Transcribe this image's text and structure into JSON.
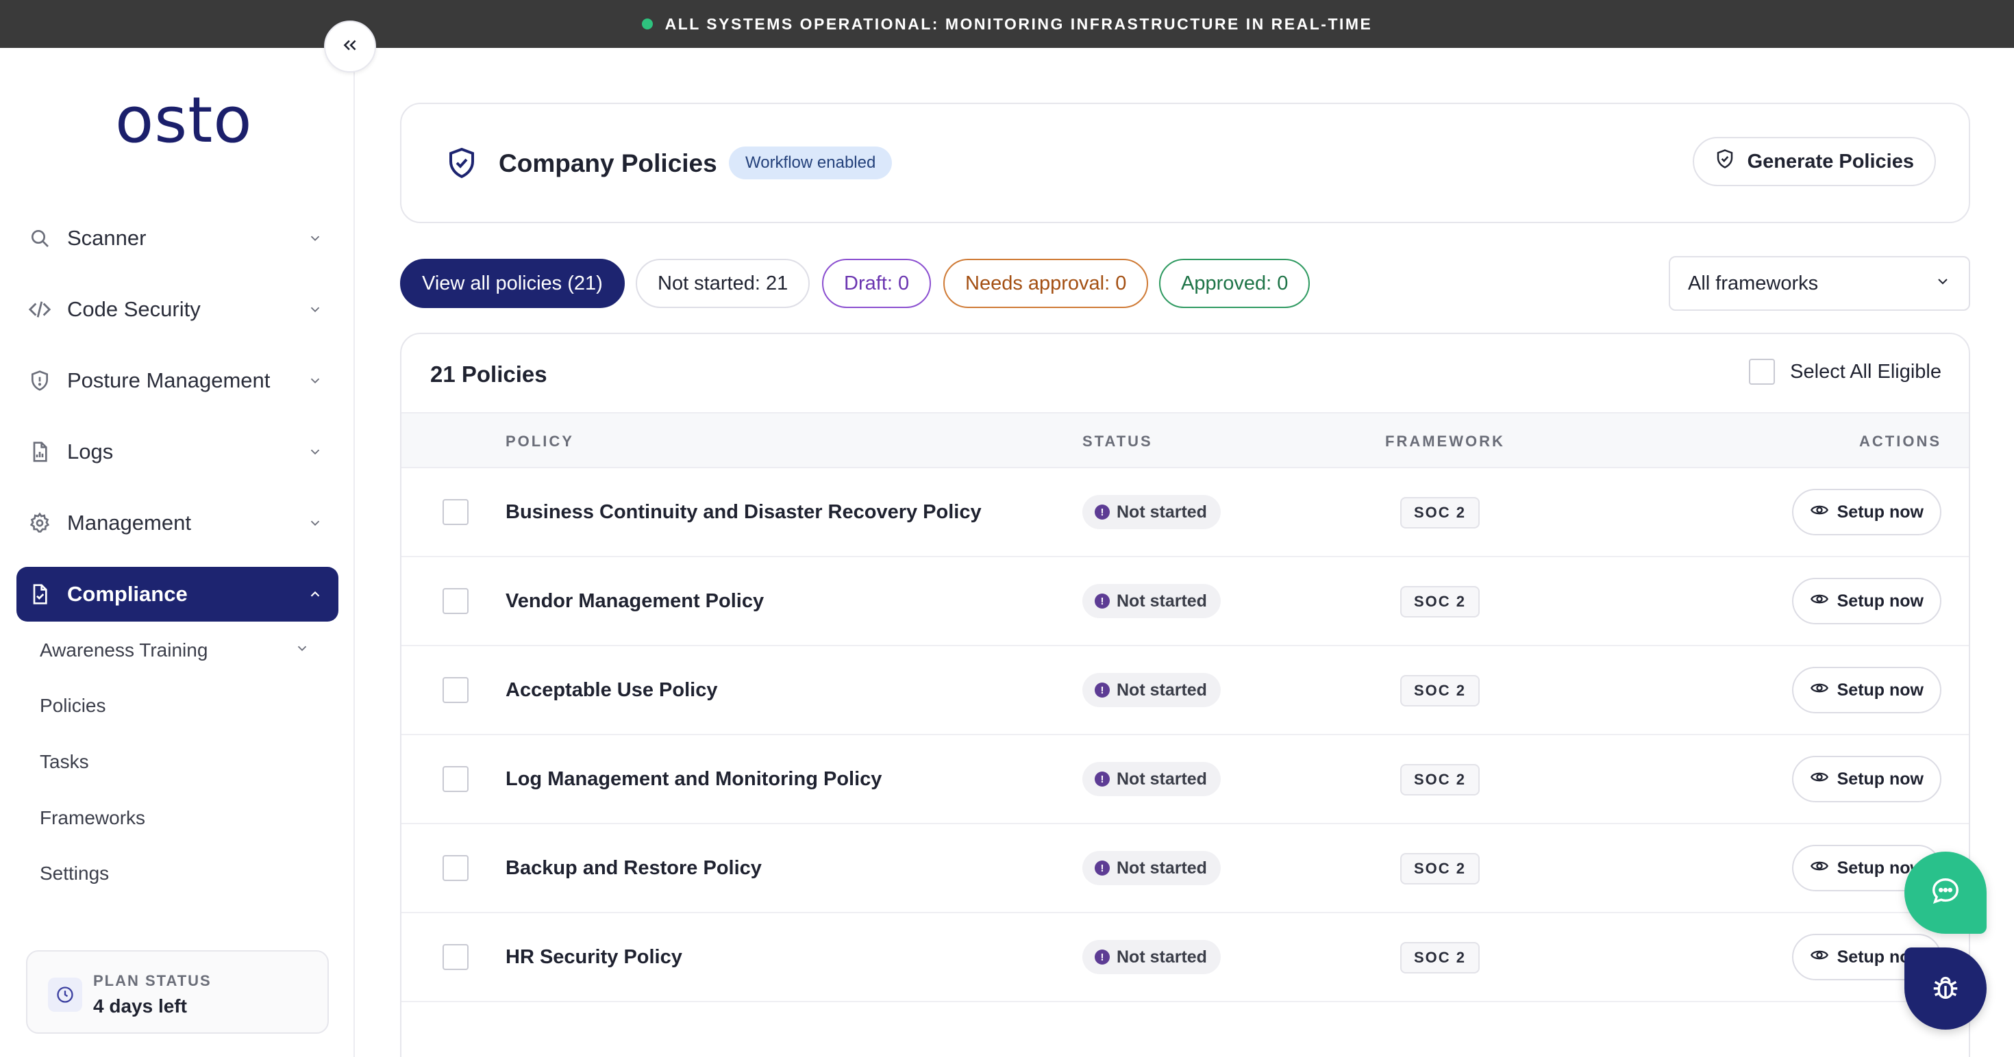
{
  "banner": {
    "text": "ALL SYSTEMS OPERATIONAL: MONITORING INFRASTRUCTURE IN REAL-TIME",
    "status_color": "#2ec27e"
  },
  "brand": {
    "logo": "osto",
    "color": "#1b1f6b"
  },
  "sidebar": {
    "items": [
      {
        "label": "Scanner",
        "icon": "search-icon"
      },
      {
        "label": "Code Security",
        "icon": "code-icon"
      },
      {
        "label": "Posture Management",
        "icon": "shield-icon"
      },
      {
        "label": "Logs",
        "icon": "file-chart-icon"
      },
      {
        "label": "Management",
        "icon": "gear-icon"
      },
      {
        "label": "Compliance",
        "icon": "file-check-icon",
        "active": true
      }
    ],
    "sub_items": [
      {
        "label": "Awareness Training"
      },
      {
        "label": "Policies"
      },
      {
        "label": "Tasks"
      },
      {
        "label": "Frameworks"
      },
      {
        "label": "Settings"
      }
    ],
    "plan": {
      "title": "PLAN STATUS",
      "value": "4 days left"
    }
  },
  "header": {
    "title": "Company Policies",
    "badge": "Workflow enabled",
    "generate_label": "Generate Policies"
  },
  "filters": {
    "all": "View all policies (21)",
    "not_started": "Not started: 21",
    "draft": "Draft: 0",
    "needs_approval": "Needs approval: 0",
    "approved": "Approved: 0",
    "framework_select": "All frameworks"
  },
  "table": {
    "count_label": "21 Policies",
    "select_all": "Select All Eligible",
    "columns": {
      "policy": "POLICY",
      "status": "STATUS",
      "framework": "FRAMEWORK",
      "actions": "ACTIONS"
    },
    "rows": [
      {
        "policy": "Business Continuity and Disaster Recovery Policy",
        "status": "Not started",
        "framework": "SOC 2",
        "action": "Setup now"
      },
      {
        "policy": "Vendor Management Policy",
        "status": "Not started",
        "framework": "SOC 2",
        "action": "Setup now"
      },
      {
        "policy": "Acceptable Use Policy",
        "status": "Not started",
        "framework": "SOC 2",
        "action": "Setup now"
      },
      {
        "policy": "Log Management and Monitoring Policy",
        "status": "Not started",
        "framework": "SOC 2",
        "action": "Setup now"
      },
      {
        "policy": "Backup and Restore Policy",
        "status": "Not started",
        "framework": "SOC 2",
        "action": "Setup now"
      },
      {
        "policy": "HR Security Policy",
        "status": "Not started",
        "framework": "SOC 2",
        "action": "Setup now"
      }
    ]
  },
  "colors": {
    "accent": "#1d2470",
    "chat": "#29c18b"
  }
}
